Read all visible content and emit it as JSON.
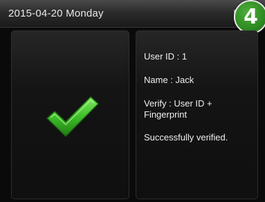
{
  "status_bar": {
    "datetime": "2015-04-20  Monday",
    "step_badge": "4",
    "status_icon": "device-status-icon"
  },
  "result_panel": {
    "icon": "checkmark-icon",
    "icon_color": "#3fbf2a"
  },
  "info_panel": {
    "user_id": "User ID : 1",
    "name": "Name : Jack",
    "verify": "Verify : User ID + Fingerprint",
    "result": "Successfully verified."
  }
}
